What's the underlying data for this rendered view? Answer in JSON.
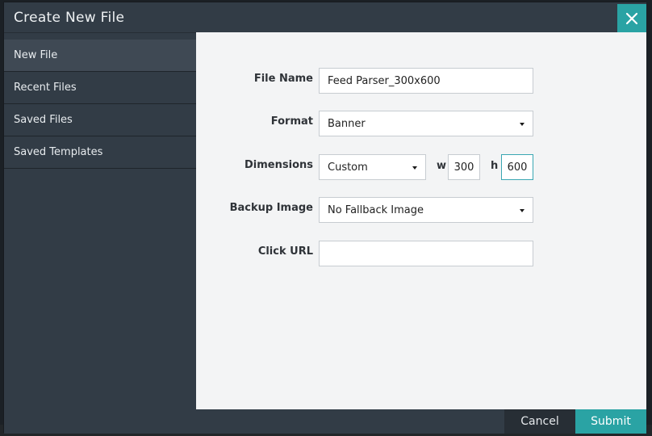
{
  "dialog": {
    "title": "Create New File",
    "close_icon": "close-icon"
  },
  "sidebar": {
    "items": [
      {
        "label": "New File",
        "active": true
      },
      {
        "label": "Recent Files"
      },
      {
        "label": "Saved Files"
      },
      {
        "label": "Saved Templates"
      }
    ]
  },
  "form": {
    "file_name": {
      "label": "File Name",
      "value": "Feed Parser_300x600"
    },
    "format": {
      "label": "Format",
      "value": "Banner"
    },
    "dimensions": {
      "label": "Dimensions",
      "preset": "Custom",
      "w_label": "w",
      "w_value": "300",
      "h_label": "h",
      "h_value": "600"
    },
    "backup_image": {
      "label": "Backup Image",
      "value": "No Fallback Image"
    },
    "click_url": {
      "label": "Click URL",
      "value": ""
    }
  },
  "footer": {
    "cancel_label": "Cancel",
    "submit_label": "Submit"
  },
  "colors": {
    "accent": "#2aa3a4",
    "panel": "#323c46",
    "content_bg": "#f3f4f5"
  }
}
